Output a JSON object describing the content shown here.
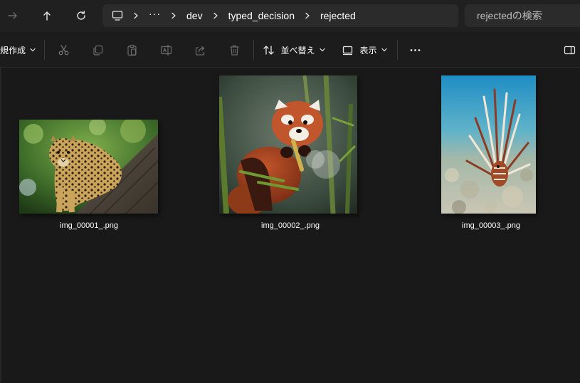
{
  "nav": {
    "forward_icon": "arrow-right-icon",
    "up_icon": "arrow-up-icon",
    "refresh_icon": "refresh-icon"
  },
  "breadcrumb": {
    "root_icon": "monitor-icon",
    "more": "···",
    "items": [
      "dev",
      "typed_decision",
      "rejected"
    ]
  },
  "search": {
    "placeholder": "rejectedの検索"
  },
  "toolbar": {
    "new_label": "規作成",
    "sort_label": "並べ替え",
    "view_label": "表示",
    "more_icon": "ellipsis-icon",
    "icons": [
      "cut-icon",
      "copy-icon",
      "paste-icon",
      "rename-icon",
      "share-icon",
      "delete-icon",
      "details-pane-icon"
    ]
  },
  "files": [
    {
      "name": "img_00001_.png",
      "subject": "leopard on tree"
    },
    {
      "name": "img_00002_.png",
      "subject": "red panda in bamboo"
    },
    {
      "name": "img_00003_.png",
      "subject": "lionfish on reef"
    }
  ],
  "colors": {
    "window_bg": "#191919",
    "bar_bg": "#202020",
    "field_bg": "#2b2b2b",
    "text": "#ffffff",
    "icon_dim": "#8a8a8a"
  }
}
